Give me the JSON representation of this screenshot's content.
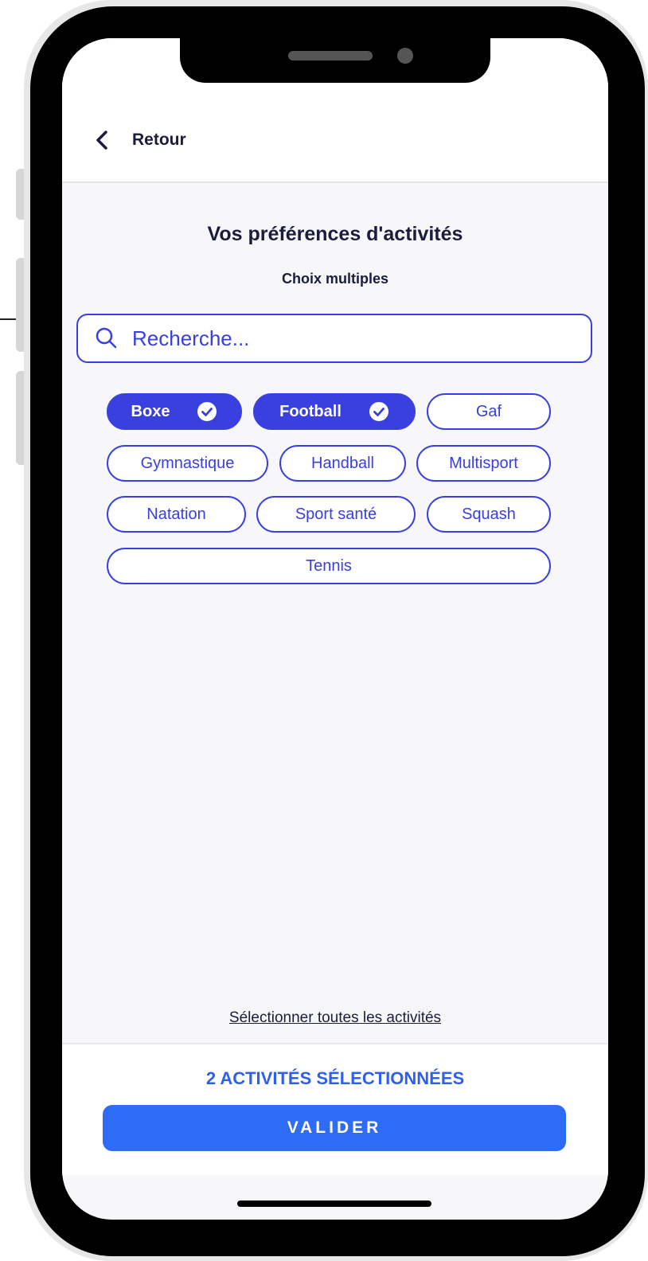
{
  "colors": {
    "accent": "#3a40e0",
    "primary_button": "#2f6cf6",
    "count_text": "#2f5ff0",
    "dark_text": "#1b1d3d",
    "screen_bg": "#f7f7f9"
  },
  "header": {
    "back_icon": "chevron-left-icon",
    "back_label": "Retour"
  },
  "page": {
    "title": "Vos préférences d'activités",
    "subtitle": "Choix multiples"
  },
  "search": {
    "icon": "search-icon",
    "placeholder": "Recherche...",
    "value": ""
  },
  "activities": [
    {
      "label": "Boxe",
      "selected": true
    },
    {
      "label": "Football",
      "selected": true
    },
    {
      "label": "Gaf",
      "selected": false
    },
    {
      "label": "Gymnastique",
      "selected": false
    },
    {
      "label": "Handball",
      "selected": false
    },
    {
      "label": "Multisport",
      "selected": false
    },
    {
      "label": "Natation",
      "selected": false
    },
    {
      "label": "Sport santé",
      "selected": false
    },
    {
      "label": "Squash",
      "selected": false
    },
    {
      "label": "Tennis",
      "selected": false
    }
  ],
  "select_all_label": "Sélectionner toutes les activités",
  "footer": {
    "selected_count_label": "2 ACTIVITÉS SÉLECTIONNÉES",
    "validate_label": "VALIDER"
  }
}
